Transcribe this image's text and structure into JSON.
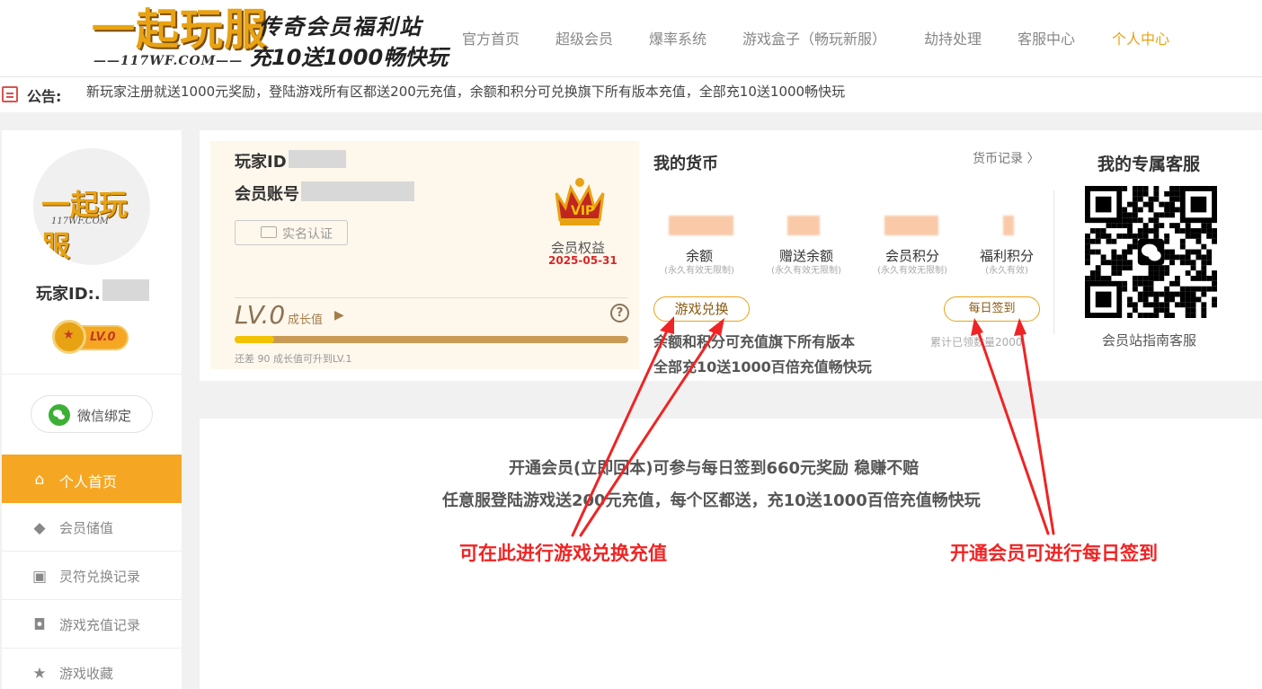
{
  "header": {
    "logo_text": "一起玩服",
    "logo_url": "——117WF.COM——",
    "slogan_line1": "传奇会员福利站",
    "slogan_line2": "充10送1000畅快玩",
    "nav": [
      "官方首页",
      "超级会员",
      "爆率系统",
      "游戏盒子（畅玩新服）",
      "劫持处理",
      "客服中心",
      "个人中心"
    ],
    "active_nav": "个人中心"
  },
  "notice": {
    "label": "公告:",
    "text": "新玩家注册就送1000元奖励，登陆游戏所有区都送200元充值，余额和积分可兑换旗下所有版本充值，全部充10送1000畅快玩"
  },
  "sidebar": {
    "avatar_logo": "一起玩服",
    "avatar_url": "117WF.COM",
    "player_id_label": "玩家ID:.",
    "level_badge": "LV.0",
    "wechat_bind": "微信绑定",
    "menu": [
      {
        "label": "个人首页",
        "icon": "home-icon",
        "active": true
      },
      {
        "label": "会员储值",
        "icon": "diamond-icon",
        "active": false
      },
      {
        "label": "灵符兑换记录",
        "icon": "exchange-icon",
        "active": false
      },
      {
        "label": "游戏充值记录",
        "icon": "gamepad-icon",
        "active": false
      },
      {
        "label": "游戏收藏",
        "icon": "star-icon",
        "active": false
      }
    ]
  },
  "vip_card": {
    "player_id_label": "玩家ID",
    "account_label": "会员账号",
    "realname_button": "实名认证",
    "rights_label": "会员权益",
    "rights_date": "2025-05-31",
    "level": "LV.0",
    "growth_label": "成长值",
    "growth_progress": 0.1,
    "upgrade_tip": "还差 90 成长值可升到LV.1"
  },
  "currency": {
    "title": "我的货币",
    "log_link": "货币记录",
    "items": [
      {
        "label": "余额",
        "sub": "(永久有效无限制)"
      },
      {
        "label": "赠送余额",
        "sub": "(永久有效无限制)"
      },
      {
        "label": "会员积分",
        "sub": "(永久有效无限制)"
      },
      {
        "label": "福利积分",
        "sub": "(永久有效)"
      }
    ],
    "exchange_button": "游戏兑换",
    "signin_button": "每日签到",
    "note_line1": "余额和积分可充值旗下所有版本",
    "note_line2": "全部充10送1000百倍充值畅快玩",
    "signed_total": "累计已领数量2000"
  },
  "service": {
    "title": "我的专属客服",
    "name": "会员站指南客服"
  },
  "main": {
    "line1": "开通会员(立即回本)可参与每日签到660元奖励 稳赚不赔",
    "line2": "任意服登陆游戏送200元充值，每个区都送，充10送1000百倍充值畅快玩",
    "annotation_exchange": "可在此进行游戏兑换充值",
    "annotation_signin": "开通会员可进行每日签到"
  },
  "colors": {
    "accent": "#f5a623",
    "annotation_red": "#ef2424",
    "date_red": "#d62727"
  }
}
